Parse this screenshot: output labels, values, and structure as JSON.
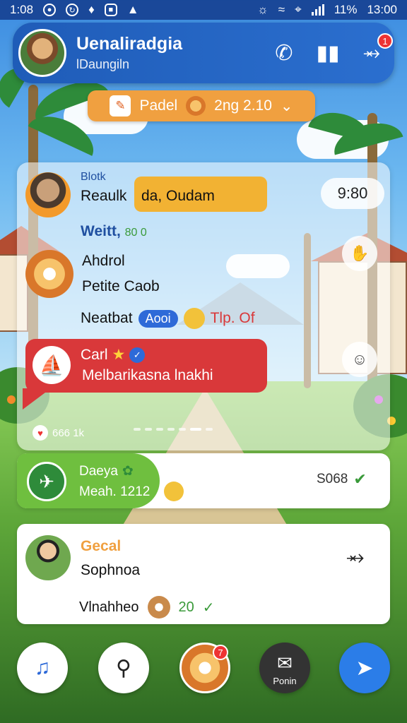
{
  "status_bar": {
    "time_left": "1:08",
    "battery": "11%",
    "time_right": "13:00"
  },
  "header": {
    "title": "Uenaliradgia",
    "subtitle": "lDaungiln",
    "notification_count": "1"
  },
  "pill": {
    "label": "Padel",
    "value": "2ng 2.10"
  },
  "messages": {
    "sender_small": "Blotk",
    "line1": "Reaulk",
    "orange_bubble": "da, Oudam",
    "time_chip": "9:80",
    "line2_bold": "Weitt,",
    "line2_rest": "80 0",
    "line3": "Ahdrol",
    "line4": "Petite Caob",
    "line5_text": "Neatbat",
    "line5_tag": "Aooi",
    "line5_extra": "Tlp. Of",
    "red_title": "Carl",
    "red_text": "Melbarikasna lnakhi",
    "footer_count": "666 1k"
  },
  "card_green": {
    "title": "Daeya",
    "subtitle": "Meah. 1212",
    "right_value": "S068"
  },
  "card_white": {
    "title": "Gecal",
    "name": "Sophnoa",
    "bottom_text": "Vlnahheo",
    "bottom_value": "20"
  },
  "nav": {
    "tiger_badge": "7",
    "profile_label": "Ponin"
  },
  "colors": {
    "header_blue": "#1f5cb8",
    "pill_orange": "#f0a040",
    "bubble_orange": "#f2b233",
    "bubble_red": "#d9383a",
    "bubble_green": "#6fbf3f",
    "fab_blue": "#2b7de8"
  }
}
